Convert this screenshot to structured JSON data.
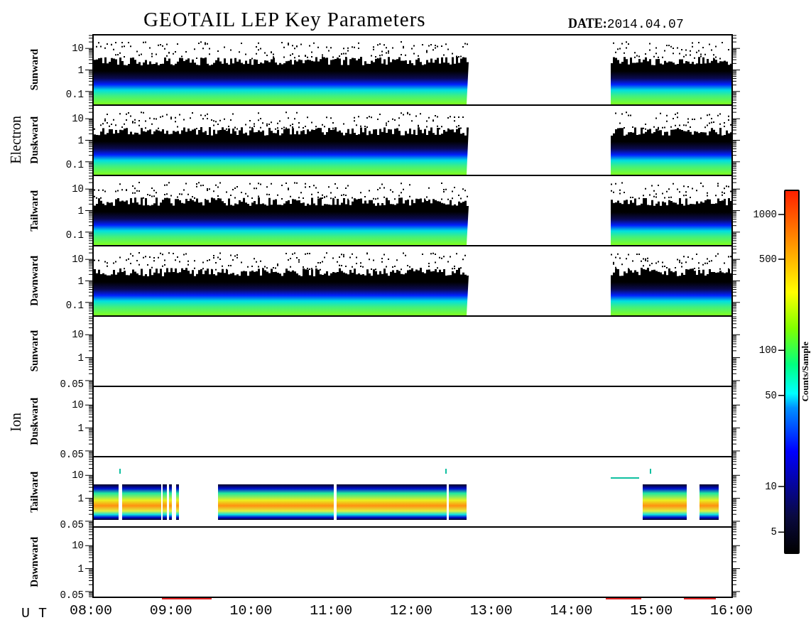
{
  "title": "GEOTAIL LEP Key Parameters",
  "date": {
    "label": "DATE:",
    "value": "2014.04.07"
  },
  "groups": [
    {
      "species": "Electron",
      "panels": [
        {
          "direction": "Sunward",
          "kind": "electron",
          "yticks": [
            "10",
            "1",
            "0.1"
          ]
        },
        {
          "direction": "Duskward",
          "kind": "electron",
          "yticks": [
            "10",
            "1",
            "0.1"
          ]
        },
        {
          "direction": "Tailward",
          "kind": "electron",
          "yticks": [
            "10",
            "1",
            "0.1"
          ]
        },
        {
          "direction": "Dawnward",
          "kind": "electron",
          "yticks": [
            "10",
            "1",
            "0.1"
          ]
        }
      ]
    },
    {
      "species": "Ion",
      "panels": [
        {
          "direction": "Sunward",
          "kind": "empty",
          "yticks": [
            "10",
            "1",
            "0.05"
          ]
        },
        {
          "direction": "Duskward",
          "kind": "empty",
          "yticks": [
            "10",
            "1",
            "0.05"
          ]
        },
        {
          "direction": "Tailward",
          "kind": "ion-band",
          "yticks": [
            "10",
            "1",
            "0.05"
          ]
        },
        {
          "direction": "Dawnward",
          "kind": "empty",
          "yticks": [
            "10",
            "1",
            "0.05"
          ]
        }
      ]
    }
  ],
  "colorbar": {
    "label": "Counts/Sample",
    "ticks": [
      "1000",
      "500",
      "100",
      "50",
      "10",
      "5"
    ]
  },
  "xaxis": {
    "label": "U T",
    "ticks": [
      "08:00",
      "09:00",
      "10:00",
      "11:00",
      "12:00",
      "13:00",
      "14:00",
      "15:00",
      "16:00"
    ]
  }
}
